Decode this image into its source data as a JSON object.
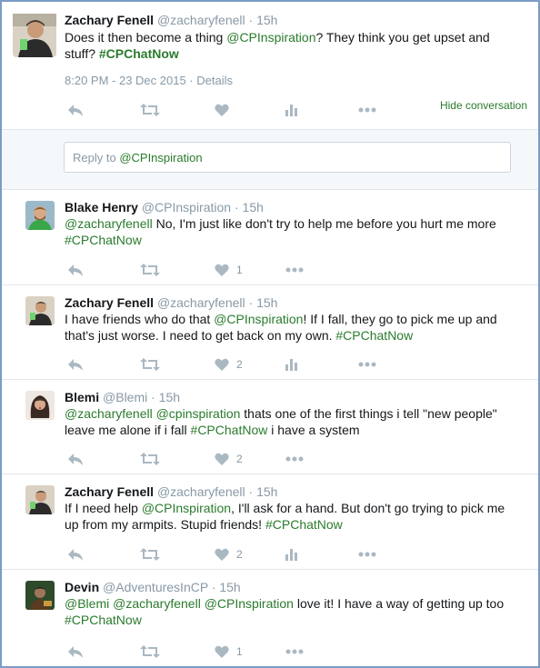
{
  "main_tweet": {
    "name": "Zachary Fenell",
    "handle": "@zacharyfenell",
    "time": "· 15h",
    "text_1": "Does it then become a thing ",
    "mention_1": "@CPInspiration",
    "text_2": "? They think you get upset and stuff? ",
    "hashtag": "#CPChatNow",
    "timestamp": "8:20 PM - 23 Dec 2015 · ",
    "details_link": "Details",
    "hide_conversation": "Hide conversation"
  },
  "reply_box": {
    "placeholder": "Reply to ",
    "mention": "@CPInspiration"
  },
  "replies": [
    {
      "name": "Blake Henry",
      "handle": "@CPInspiration",
      "time": "· 15h",
      "parts": [
        {
          "t": "@zacharyfenell",
          "k": "mention-g"
        },
        {
          "t": " No, I'm just like don't try to help me before you hurt me more ",
          "k": "text"
        },
        {
          "t": "#CPChatNow",
          "k": "tag"
        }
      ],
      "like_count": "1"
    },
    {
      "name": "Zachary Fenell",
      "handle": "@zacharyfenell",
      "time": "· 15h",
      "parts": [
        {
          "t": "I have friends who do that ",
          "k": "text"
        },
        {
          "t": "@CPInspiration",
          "k": "mention-g"
        },
        {
          "t": "! If I fall, they go to pick me up and that's just worse. I need to get back on my own. ",
          "k": "text"
        },
        {
          "t": "#CPChatNow",
          "k": "tag"
        }
      ],
      "like_count": "2"
    },
    {
      "name": "Blemi",
      "handle": "@Blemi",
      "time": "· 15h",
      "parts": [
        {
          "t": "@zacharyfenell",
          "k": "mention-g"
        },
        {
          "t": " ",
          "k": "text"
        },
        {
          "t": "@cpinspiration",
          "k": "mention-g"
        },
        {
          "t": " thats one of the first things i tell \"new people\" leave me alone if i fall ",
          "k": "text"
        },
        {
          "t": "#CPChatNow",
          "k": "tag"
        },
        {
          "t": " i have a system",
          "k": "text"
        }
      ],
      "like_count": "2"
    },
    {
      "name": "Zachary Fenell",
      "handle": "@zacharyfenell",
      "time": "· 15h",
      "parts": [
        {
          "t": "If I need help ",
          "k": "text"
        },
        {
          "t": "@CPInspiration",
          "k": "mention-g"
        },
        {
          "t": ", I'll ask for a hand. But don't go trying to pick me up from my armpits. Stupid friends! ",
          "k": "text"
        },
        {
          "t": "#CPChatNow",
          "k": "tag"
        }
      ],
      "like_count": "2"
    },
    {
      "name": "Devin",
      "handle": "@AdventuresInCP",
      "time": "· 15h",
      "parts": [
        {
          "t": "@Blemi",
          "k": "mention-g"
        },
        {
          "t": " ",
          "k": "text"
        },
        {
          "t": "@zacharyfenell",
          "k": "mention-g"
        },
        {
          "t": " ",
          "k": "text"
        },
        {
          "t": "@CPInspiration",
          "k": "mention-g"
        },
        {
          "t": " love it! I have a way of getting up too ",
          "k": "text"
        },
        {
          "t": "#CPChatNow",
          "k": "tag"
        }
      ],
      "like_count": "1"
    }
  ],
  "icons": {
    "reply": "reply-icon",
    "retweet": "retweet-icon",
    "like": "heart-icon",
    "analytics": "analytics-icon",
    "more": "more-icon"
  },
  "colors": {
    "link_green": "#2a7b2d",
    "muted": "#8899a6",
    "icon": "#aab8c2",
    "border": "#7a9cc6"
  }
}
